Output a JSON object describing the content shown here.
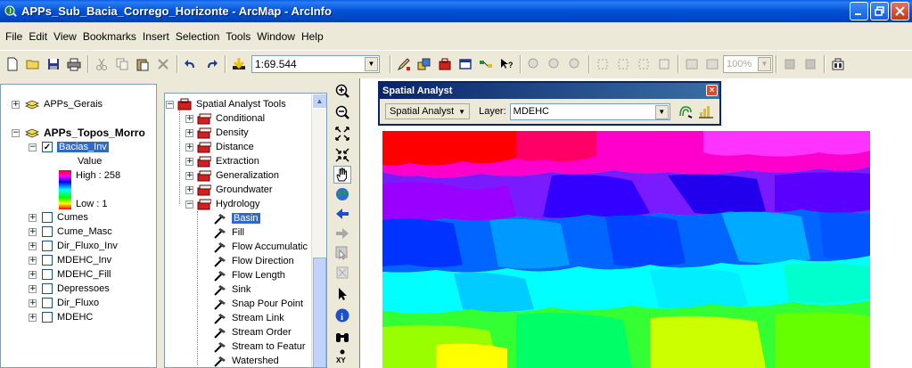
{
  "window": {
    "title": "APPs_Sub_Bacia_Corrego_Horizonte - ArcMap - ArcInfo"
  },
  "menu": [
    "File",
    "Edit",
    "View",
    "Bookmarks",
    "Insert",
    "Selection",
    "Tools",
    "Window",
    "Help"
  ],
  "toolbar": {
    "scale": "1:69.544",
    "zoom": "100%"
  },
  "toc": {
    "layers": [
      {
        "name": "APPs_Gerais",
        "type": "group"
      },
      {
        "name": "APPs_Topos_Morro",
        "type": "group"
      },
      {
        "name": "Bacias_Inv",
        "checked": true,
        "selected": true
      },
      {
        "name": "Cumes",
        "checked": false
      },
      {
        "name": "Cume_Masc",
        "checked": false
      },
      {
        "name": "Dir_Fluxo_Inv",
        "checked": false
      },
      {
        "name": "MDEHC_Inv",
        "checked": false
      },
      {
        "name": "MDEHC_Fill",
        "checked": false
      },
      {
        "name": "Depressoes",
        "checked": false
      },
      {
        "name": "Dir_Fluxo",
        "checked": false
      },
      {
        "name": "MDEHC",
        "checked": false
      }
    ],
    "legend": {
      "title": "Value",
      "high": "High : 258",
      "low": "Low : 1"
    }
  },
  "tools": {
    "root": "Spatial Analyst Tools",
    "toolsets": [
      "Conditional",
      "Density",
      "Distance",
      "Extraction",
      "Generalization",
      "Groundwater",
      "Hydrology"
    ],
    "hydrology_tools": [
      "Basin",
      "Fill",
      "Flow Accumulatic",
      "Flow Direction",
      "Flow Length",
      "Sink",
      "Snap Pour Point",
      "Stream Link",
      "Stream Order",
      "Stream to Featur",
      "Watershed"
    ]
  },
  "spatial_analyst": {
    "title": "Spatial Analyst",
    "menu_label": "Spatial Analyst",
    "layer_label": "Layer:",
    "layer_value": "MDEHC"
  },
  "colors": {
    "titlebar": "#0055e5",
    "selection": "#316ac5",
    "sa_titlebar": "#0a246a"
  }
}
